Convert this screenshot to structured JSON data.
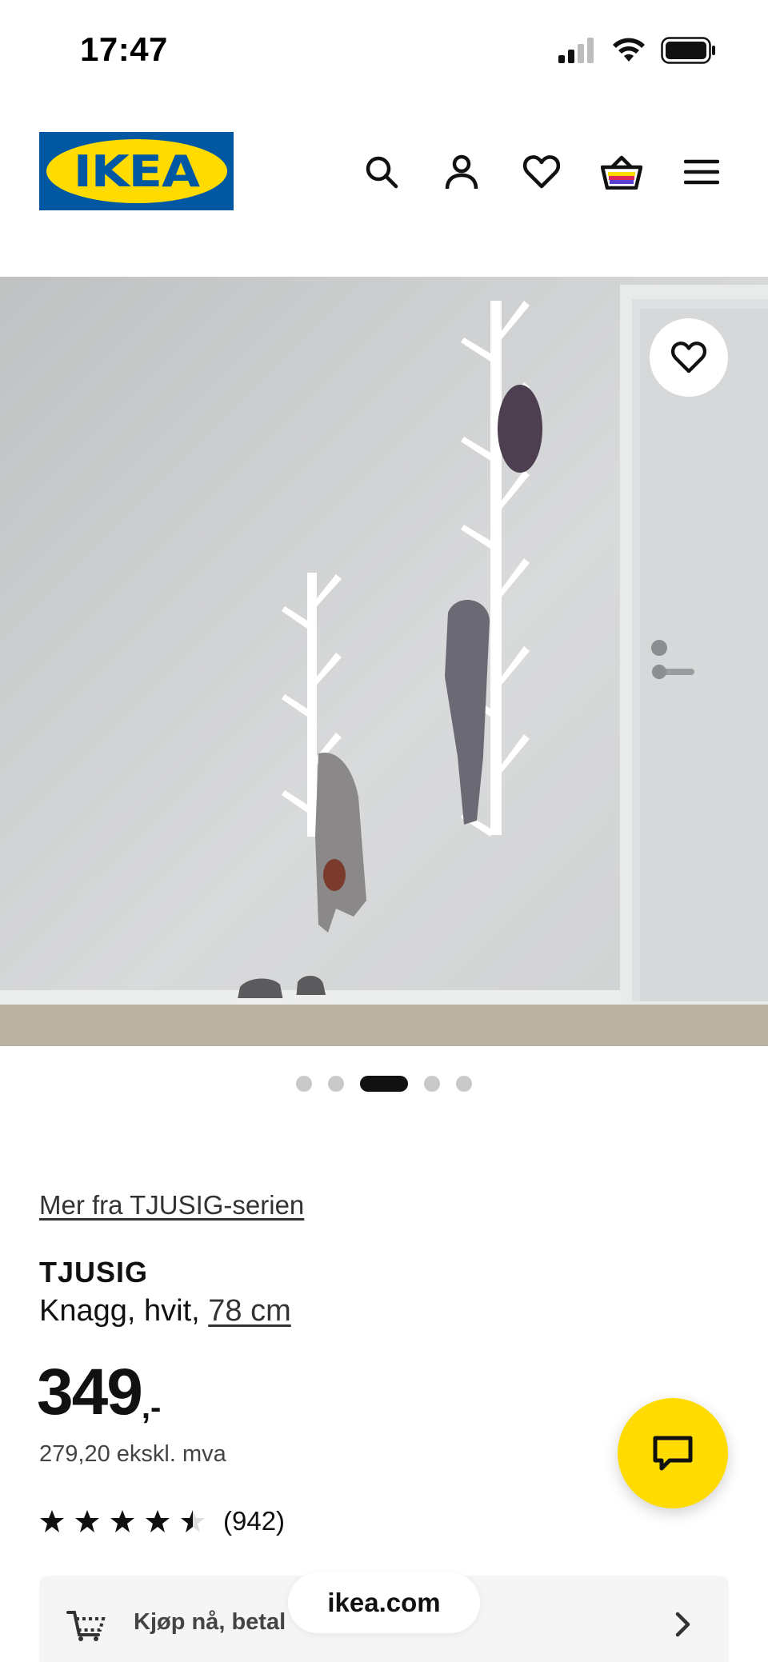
{
  "status_bar": {
    "time": "17:47",
    "icons": [
      "signal-icon",
      "wifi-icon",
      "battery-icon"
    ]
  },
  "header": {
    "logo_text": "IKEA",
    "icons": [
      "search-icon",
      "account-icon",
      "heart-icon",
      "basket-icon",
      "menu-icon"
    ]
  },
  "hero": {
    "favorite_icon": "heart-icon",
    "carousel_dot_count": 5,
    "active_dot_index": 2
  },
  "product": {
    "series_link": "Mer fra TJUSIG-serien",
    "name": "TJUSIG",
    "description": "Knagg, hvit, ",
    "size": "78 cm",
    "price_integer": "349",
    "price_suffix": ",-",
    "price_ex_vat": "279,20 ekskl. mva",
    "rating": 4.5,
    "rating_max": 5,
    "rating_count": "(942)"
  },
  "chat": {
    "icon": "chat-icon"
  },
  "klarna": {
    "text": "Kjøp nå, betal",
    "icon": "cart-icon"
  },
  "browser": {
    "url": "ikea.com"
  },
  "colors": {
    "brand_blue": "#0058a3",
    "brand_yellow": "#ffdb00",
    "text": "#111111"
  }
}
